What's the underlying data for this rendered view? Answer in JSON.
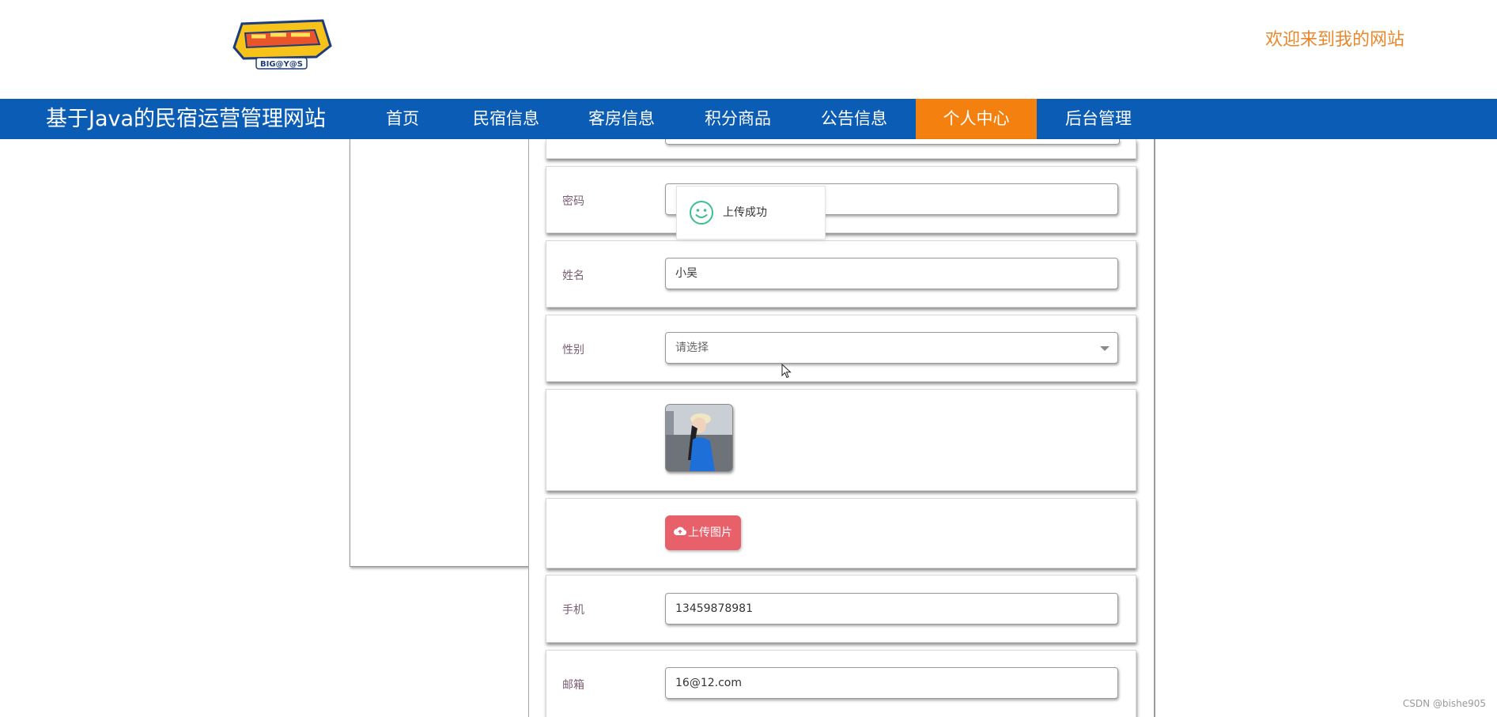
{
  "header": {
    "logo_text": "BIG@Y@S",
    "welcome": "欢迎来到我的网站"
  },
  "navbar": {
    "site_title": "基于Java的民宿运营管理网站",
    "items": [
      {
        "label": "首页",
        "active": false
      },
      {
        "label": "民宿信息",
        "active": false
      },
      {
        "label": "客房信息",
        "active": false
      },
      {
        "label": "积分商品",
        "active": false
      },
      {
        "label": "公告信息",
        "active": false
      },
      {
        "label": "个人中心",
        "active": true
      },
      {
        "label": "后台管理",
        "active": false
      }
    ],
    "colors": {
      "bar": "#0b5cb5",
      "active": "#f4800f"
    }
  },
  "form": {
    "password_label": "密码",
    "password_value": "",
    "name_label": "姓名",
    "name_value": "小吴",
    "gender_label": "性别",
    "gender_placeholder": "请选择",
    "upload_button": "上传图片",
    "phone_label": "手机",
    "phone_value": "13459878981",
    "email_label": "邮箱",
    "email_value": "16@12.com"
  },
  "toast": {
    "message": "上传成功",
    "icon": "smile-icon"
  },
  "watermark": "CSDN @bishe905"
}
